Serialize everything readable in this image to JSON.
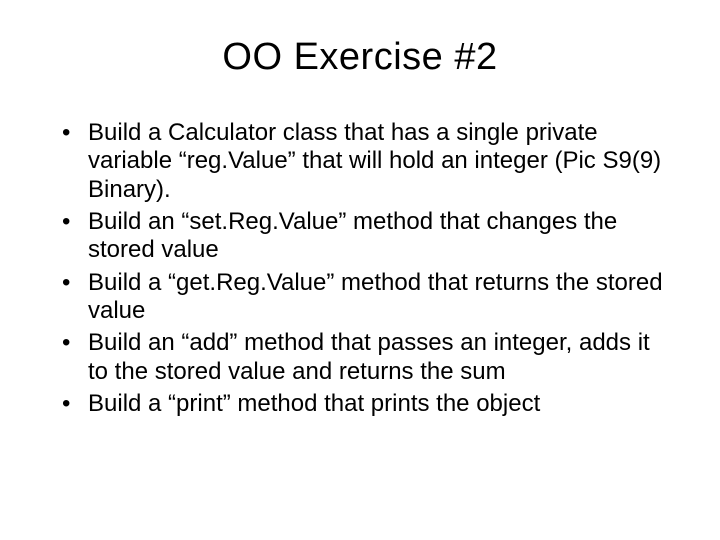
{
  "title": "OO Exercise #2",
  "bullets": [
    "Build a Calculator class that has a single private variable “reg.Value” that will hold an integer (Pic S9(9) Binary).",
    "Build an “set.Reg.Value” method that changes the stored value",
    "Build a “get.Reg.Value” method that returns the stored value",
    "Build an “add” method that passes an integer, adds it to the stored value and returns the sum",
    "Build a “print” method that prints the object"
  ]
}
